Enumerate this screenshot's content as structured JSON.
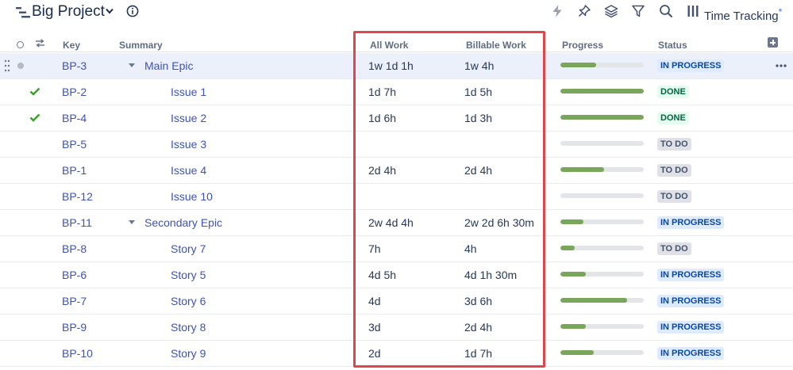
{
  "toolbar": {
    "project_title": "Big Project",
    "view_name": "Time Tracking",
    "view_modified_marker": "*",
    "accent": "#3d52b8"
  },
  "columns": {
    "key": "Key",
    "summary": "Summary",
    "all_work": "All Work",
    "billable_work": "Billable Work",
    "progress": "Progress",
    "status": "Status"
  },
  "rows": [
    {
      "key": "BP-3",
      "summary": "Main Epic",
      "all_work": "1w 1d 1h",
      "billable": "1w 4h",
      "progress": 0.43,
      "status": "IN PROGRESS",
      "done": false,
      "expandable": true,
      "level": 0,
      "selected": true
    },
    {
      "key": "BP-2",
      "summary": "Issue 1",
      "all_work": "1d 7h",
      "billable": "1d 5h",
      "progress": 1.0,
      "status": "DONE",
      "done": true,
      "expandable": false,
      "level": 1,
      "selected": false
    },
    {
      "key": "BP-4",
      "summary": "Issue 2",
      "all_work": "1d 6h",
      "billable": "1d 3h",
      "progress": 1.0,
      "status": "DONE",
      "done": true,
      "expandable": false,
      "level": 1,
      "selected": false
    },
    {
      "key": "BP-5",
      "summary": "Issue 3",
      "all_work": "",
      "billable": "",
      "progress": 0.0,
      "status": "TO DO",
      "done": false,
      "expandable": false,
      "level": 1,
      "selected": false
    },
    {
      "key": "BP-1",
      "summary": "Issue 4",
      "all_work": "2d 4h",
      "billable": "2d 4h",
      "progress": 0.52,
      "status": "TO DO",
      "done": false,
      "expandable": false,
      "level": 1,
      "selected": false
    },
    {
      "key": "BP-12",
      "summary": "Issue 10",
      "all_work": "",
      "billable": "",
      "progress": 0.0,
      "status": "TO DO",
      "done": false,
      "expandable": false,
      "level": 1,
      "selected": false
    },
    {
      "key": "BP-11",
      "summary": "Secondary Epic",
      "all_work": "2w 4d 4h",
      "billable": "2w 2d 6h 30m",
      "progress": 0.28,
      "status": "IN PROGRESS",
      "done": false,
      "expandable": true,
      "level": 0,
      "selected": false
    },
    {
      "key": "BP-8",
      "summary": "Story 7",
      "all_work": "7h",
      "billable": "4h",
      "progress": 0.17,
      "status": "TO DO",
      "done": false,
      "expandable": false,
      "level": 1,
      "selected": false
    },
    {
      "key": "BP-6",
      "summary": "Story 5",
      "all_work": "4d 5h",
      "billable": "4d 1h 30m",
      "progress": 0.3,
      "status": "IN PROGRESS",
      "done": false,
      "expandable": false,
      "level": 1,
      "selected": false
    },
    {
      "key": "BP-7",
      "summary": "Story 6",
      "all_work": "4d",
      "billable": "3d 6h",
      "progress": 0.8,
      "status": "IN PROGRESS",
      "done": false,
      "expandable": false,
      "level": 1,
      "selected": false
    },
    {
      "key": "BP-9",
      "summary": "Story 8",
      "all_work": "3d",
      "billable": "2d 4h",
      "progress": 0.3,
      "status": "IN PROGRESS",
      "done": false,
      "expandable": false,
      "level": 1,
      "selected": false
    },
    {
      "key": "BP-10",
      "summary": "Story 9",
      "all_work": "2d",
      "billable": "1d 7h",
      "progress": 0.4,
      "status": "IN PROGRESS",
      "done": false,
      "expandable": false,
      "level": 1,
      "selected": false
    }
  ],
  "status_colors": {
    "IN PROGRESS": "#0747a6",
    "DONE": "#006644",
    "TO DO": "#42526e"
  },
  "progress_color": "#79a65a",
  "highlight_color": "#e0464a",
  "icons": [
    "structure-icon",
    "chevron-down-icon",
    "info-icon",
    "lightning-icon",
    "pin-icon",
    "layers-icon",
    "filter-icon",
    "search-icon",
    "columns-icon",
    "add-column-icon",
    "checkmark-icon",
    "drag-handle-icon",
    "more-icon"
  ]
}
